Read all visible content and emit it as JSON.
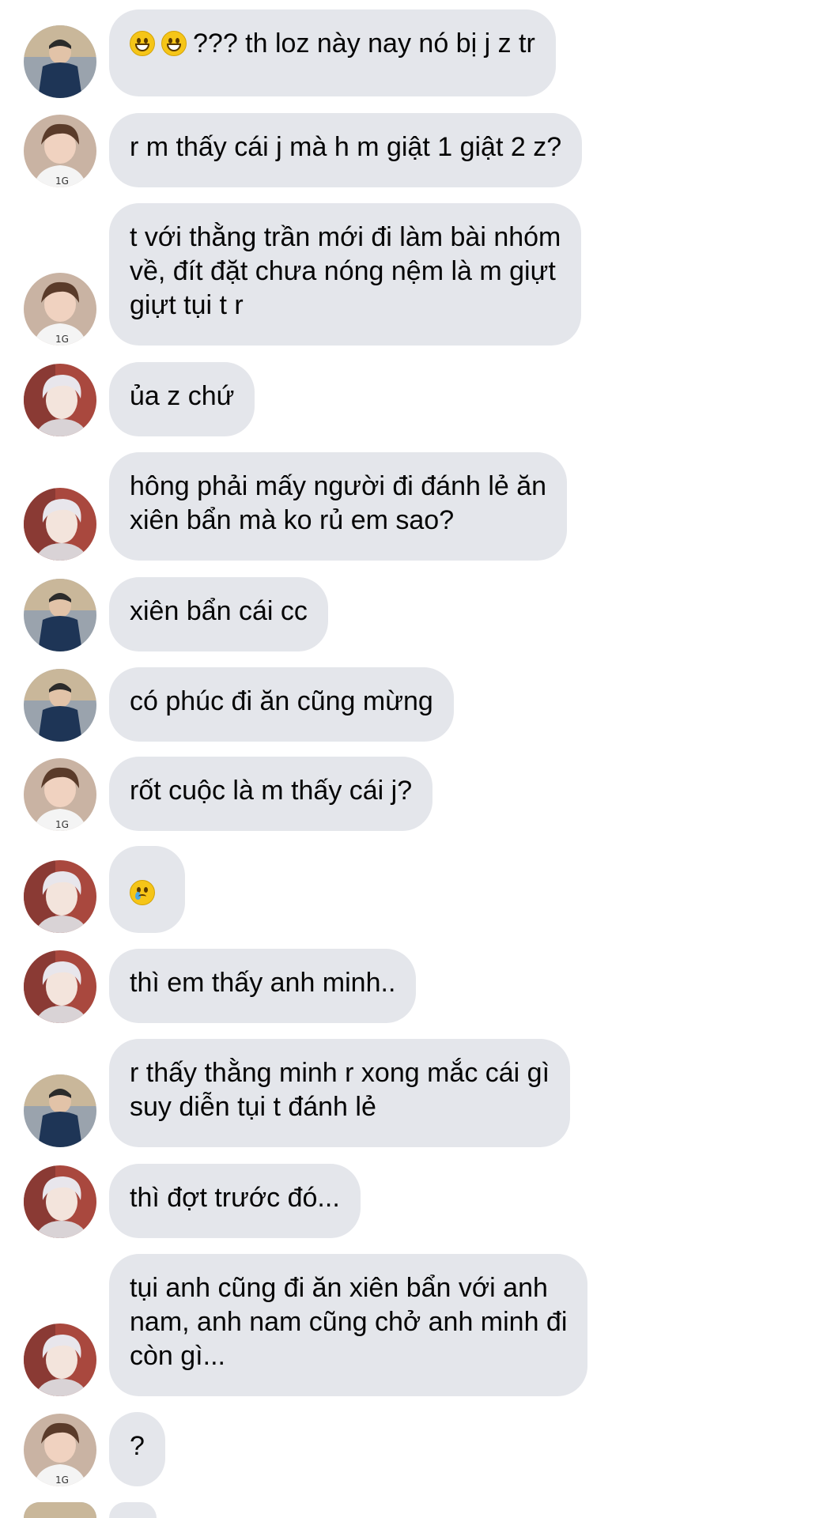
{
  "messages": [
    {
      "sender": "a",
      "text": "??? th loz này nay nó bị j z tr",
      "emoji_prefix": [
        "grinning-face",
        "grinning-face"
      ]
    },
    {
      "sender": "b",
      "text": "r m thấy cái j mà h m giật 1 giật 2 z?"
    },
    {
      "sender": "b",
      "text": "t với thằng trần mới đi làm bài nhóm\nvề, đít đặt chưa nóng nệm là m giựt\ngiựt tụi t r"
    },
    {
      "sender": "c",
      "text": "ủa z chứ"
    },
    {
      "sender": "c",
      "text": "hông phải mấy người đi đánh lẻ ăn\nxiên bẩn mà ko rủ em sao?"
    },
    {
      "sender": "a",
      "text": "xiên bẩn cái cc"
    },
    {
      "sender": "a",
      "text": "có phúc đi ăn cũng mừng"
    },
    {
      "sender": "b",
      "text": "rốt cuộc là m thấy cái j?"
    },
    {
      "sender": "c",
      "text": "",
      "emoji_only": "crying-face"
    },
    {
      "sender": "c",
      "text": "thì em thấy anh minh.."
    },
    {
      "sender": "a",
      "text": "r thấy thằng minh r xong mắc cái gì\nsuy diễn tụi t đánh lẻ"
    },
    {
      "sender": "c",
      "text": "thì đợt trước đó..."
    },
    {
      "sender": "c",
      "text": "tụi anh cũng đi ăn xiên bẩn với anh\nnam, anh nam cũng chở anh minh đi\ncòn gì..."
    },
    {
      "sender": "b",
      "text": "?"
    }
  ],
  "colors": {
    "bubble_background": "#e4e6eb",
    "text": "#050505",
    "background": "#ffffff"
  }
}
